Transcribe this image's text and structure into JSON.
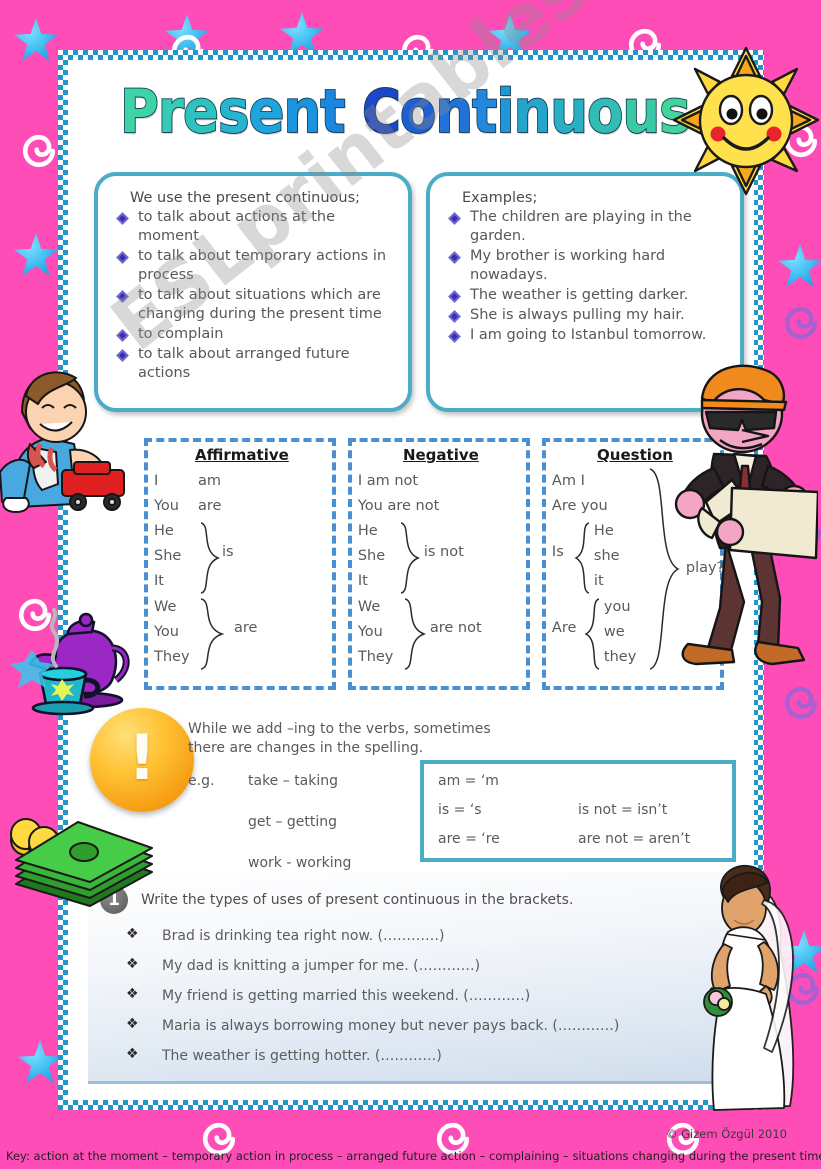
{
  "title": {
    "line": "Present Continuous",
    "letters": [
      {
        "ch": "P",
        "color": "#3fd3a8"
      },
      {
        "ch": "r",
        "color": "#35cbb4"
      },
      {
        "ch": "e",
        "color": "#2ec2bf"
      },
      {
        "ch": "s",
        "color": "#27b4cf"
      },
      {
        "ch": "e",
        "color": "#1fa4dc"
      },
      {
        "ch": "n",
        "color": "#1b94e0"
      },
      {
        "ch": "t",
        "color": "#1a86de"
      },
      {
        "ch": " ",
        "color": "#1a86de"
      },
      {
        "ch": "C",
        "color": "#1b47c9"
      },
      {
        "ch": "o",
        "color": "#1f5fd4"
      },
      {
        "ch": "n",
        "color": "#2173d9"
      },
      {
        "ch": "t",
        "color": "#2387dd"
      },
      {
        "ch": "i",
        "color": "#2196d8"
      },
      {
        "ch": "n",
        "color": "#25a4ce"
      },
      {
        "ch": "u",
        "color": "#2ab0c4"
      },
      {
        "ch": "o",
        "color": "#31bcb6"
      },
      {
        "ch": "u",
        "color": "#39c9a7"
      },
      {
        "ch": "s",
        "color": "#42d49a"
      }
    ]
  },
  "uses_panel": {
    "heading": "We use the present continuous;",
    "items": [
      "to talk about actions at the moment",
      "to talk about temporary actions in process",
      "to talk about situations which are changing during the present time",
      "to complain",
      "to talk about arranged future actions"
    ]
  },
  "examples_panel": {
    "heading": "Examples;",
    "items": [
      "The children are playing in the garden.",
      "My brother is working hard nowadays.",
      "The weather is getting darker.",
      "She is always pulling my hair.",
      "I am going to Istanbul tomorrow."
    ]
  },
  "tables": {
    "affirmative": {
      "title": "Affirmative",
      "simple_rows": [
        {
          "subject": "I",
          "verb": "am"
        },
        {
          "subject": "You",
          "verb": "are"
        }
      ],
      "group1": {
        "subjects": [
          "He",
          "She",
          "It"
        ],
        "verb": "is"
      },
      "group2": {
        "subjects": [
          "We",
          "You",
          "They"
        ],
        "verb": "are"
      }
    },
    "negative": {
      "title": "Negative",
      "simple_rows": [
        {
          "text": "I am not"
        },
        {
          "text": "You are not"
        }
      ],
      "group1": {
        "subjects": [
          "He",
          "She",
          "It"
        ],
        "verb": "is not"
      },
      "group2": {
        "subjects": [
          "We",
          "You",
          "They"
        ],
        "verb": "are not"
      }
    },
    "question": {
      "title": "Question",
      "simple_rows": [
        {
          "text": "Am I"
        },
        {
          "text": "Are you"
        }
      ],
      "group1": {
        "lead": "Is",
        "subjects": [
          "He",
          "she",
          "it"
        ]
      },
      "group2": {
        "lead": "Are",
        "subjects": [
          "you",
          "we",
          "they"
        ]
      },
      "verb": "play?"
    }
  },
  "spelling": {
    "note": "While we add –ing to the verbs, sometimes there are changes in the spelling.",
    "eg_label": "e.g.",
    "examples": [
      "take – taking",
      "get – getting",
      "work - working"
    ],
    "warning_glyph": "!"
  },
  "contractions": {
    "rows": [
      {
        "left": "am = ‘m",
        "right": ""
      },
      {
        "left": "is = ‘s",
        "right": "is not = isn’t"
      },
      {
        "left": "are = ‘re",
        "right": "are not = aren’t"
      }
    ]
  },
  "exercise": {
    "number": "1",
    "instruction": "Write the types of uses of present continuous in the brackets.",
    "items": [
      "Brad is drinking tea right now. (…………)",
      "My dad is knitting a jumper for me. (…………)",
      "My friend is getting married this weekend. (…………)",
      "Maria is always borrowing money but never pays back. (…………)",
      "The weather is getting hotter. (…………)"
    ]
  },
  "footer": {
    "copyright": "© Gizem Özgül 2010",
    "key": "Key: action at the moment – temporary action in process – arranged future action – complaining – situations changing during the present time"
  },
  "watermark": "ESLprintables.com",
  "colors": {
    "background_pink": "#ff4db8",
    "border_blue": "#2196ce",
    "panel_border": "#4aacc5",
    "table_dash": "#4a8fd0",
    "bullet_diamond": "#3b2fae"
  },
  "clipart": {
    "sun": "sun-icon",
    "boy_with_car": "boy-playing-toy-car-image",
    "teapot": "teapot-and-cup-image",
    "architect": "architect-with-blueprints-image",
    "money": "money-stack-image",
    "bride": "bride-image",
    "stars": "star-icon",
    "spirals": "spiral-icon"
  }
}
